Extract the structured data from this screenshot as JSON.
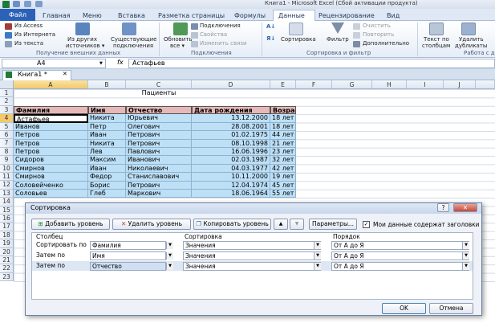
{
  "window": {
    "title": "Книга1 - Microsoft Excel (Сбой активации продукта)"
  },
  "ribbon_tabs": [
    "Файл",
    "Главная",
    "Меню",
    "Вставка",
    "Разметка страницы",
    "Формулы",
    "Данные",
    "Рецензирование",
    "Вид"
  ],
  "ribbon": {
    "ext_data": {
      "access": "Из Access",
      "web": "Из Интернета",
      "text": "Из текста",
      "other": "Из других",
      "other2": "источников ▾",
      "existing": "Существующие",
      "existing2": "подключения",
      "label": "Получение внешних данных"
    },
    "connections": {
      "refresh": "Обновить",
      "refresh2": "все ▾",
      "conns": "Подключения",
      "props": "Свойства",
      "edit": "Изменить связи",
      "label": "Подключения"
    },
    "sort": {
      "sort": "Сортировка",
      "filter": "Фильтр",
      "clear": "Очистить",
      "reapply": "Повторить",
      "advanced": "Дополнительно",
      "label": "Сортировка и фильтр"
    },
    "tools": {
      "text_cols": "Текст по",
      "text_cols2": "столбцам",
      "remove_dup": "Удалить",
      "remove_dup2": "дубликаты",
      "label": "Работа с да"
    }
  },
  "formula_bar": {
    "name_box": "A4",
    "fx": "fx",
    "value": "Астафьев"
  },
  "workbook_tab": "Книга1 *",
  "columns": [
    "A",
    "B",
    "C",
    "D",
    "E",
    "F",
    "G",
    "H",
    "I",
    "J"
  ],
  "rows": [
    "1",
    "2",
    "3",
    "4",
    "5",
    "6",
    "7",
    "8",
    "9",
    "10",
    "11",
    "12",
    "13",
    "14",
    "15",
    "16",
    "17",
    "18",
    "19",
    "20",
    "21",
    "22",
    "23"
  ],
  "sheet": {
    "title": "Пациенты",
    "headers": [
      "Фамилия",
      "Имя",
      "Отчество",
      "Дата рождения",
      "Возраст"
    ],
    "records": [
      [
        "Астафьев",
        "Никита",
        "Юрьевич",
        "13.12.2000",
        "18 лет"
      ],
      [
        "Иванов",
        "Петр",
        "Олегович",
        "28.08.2001",
        "18 лет"
      ],
      [
        "Петров",
        "Иван",
        "Петрович",
        "01.02.1975",
        "44 лет"
      ],
      [
        "Петров",
        "Никита",
        "Петрович",
        "08.10.1998",
        "21 лет"
      ],
      [
        "Петров",
        "Лев",
        "Павлович",
        "16.06.1996",
        "23 лет"
      ],
      [
        "Сидоров",
        "Максим",
        "Иванович",
        "02.03.1987",
        "32 лет"
      ],
      [
        "Смирнов",
        "Иван",
        "Николаевич",
        "04.03.1977",
        "42 лет"
      ],
      [
        "Смирнов",
        "Федор",
        "Станиславович",
        "10.11.2000",
        "19 лет"
      ],
      [
        "Соловейченко",
        "Борис",
        "Петрович",
        "12.04.1974",
        "45 лет"
      ],
      [
        "Соловьев",
        "Глеб",
        "Маркович",
        "18.06.1964",
        "55 лет"
      ]
    ]
  },
  "dialog": {
    "title": "Сортировка",
    "help": "?",
    "close": "✕",
    "add_level": "Добавить уровень",
    "delete_level": "Удалить уровень",
    "copy_level": "Копировать уровень",
    "up": "▲",
    "down": "▼",
    "options": "Параметры...",
    "has_headers": "Мои данные содержат заголовки",
    "col_header": "Столбец",
    "sort_on_header": "Сортировка",
    "order_header": "Порядок",
    "levels": [
      {
        "label": "Сортировать по",
        "column": "Фамилия",
        "sort_on": "Значения",
        "order": "От А до Я"
      },
      {
        "label": "Затем по",
        "column": "Имя",
        "sort_on": "Значения",
        "order": "От А до Я"
      },
      {
        "label": "Затем по",
        "column": "Отчество",
        "sort_on": "Значения",
        "order": "От А до Я"
      }
    ],
    "ok": "OK",
    "cancel": "Отмена"
  }
}
